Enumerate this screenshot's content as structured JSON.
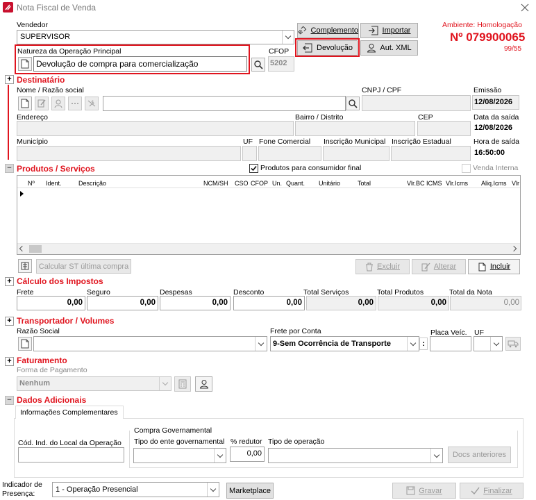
{
  "window": {
    "title": "Nota Fiscal de Venda"
  },
  "header": {
    "ambiente": "Ambiente: Homologação",
    "numero": "Nº 079900065",
    "serie": "99/55",
    "vendedor_label": "Vendedor",
    "vendedor_value": "SUPERVISOR",
    "natureza_label": "Natureza da Operação Principal",
    "natureza_value": "Devolução de compra para comercialização",
    "cfop_label": "CFOP",
    "cfop_value": "5202",
    "btn_complemento": "Complemento",
    "btn_importar": "Importar",
    "btn_devolucao": "Devolução",
    "btn_autxml": "Aut. XML"
  },
  "destinatario": {
    "title": "Destinatário",
    "nome_label": "Nome / Razão social",
    "cnpj_label": "CNPJ / CPF",
    "emissao_label": "Emissão",
    "emissao_value": "12/08/2026",
    "endereco_label": "Endereço",
    "bairro_label": "Bairro / Distrito",
    "cep_label": "CEP",
    "data_saida_label": "Data da saída",
    "data_saida_value": "12/08/2026",
    "municipio_label": "Município",
    "uf_label": "UF",
    "fone_label": "Fone Comercial",
    "im_label": "Inscrição Municipal",
    "ie_label": "Inscrição Estadual",
    "hora_saida_label": "Hora de saída",
    "hora_saida_value": "16:50:00"
  },
  "produtos": {
    "title": "Produtos / Serviços",
    "consumidor_final": "Produtos para consumidor final",
    "venda_interna": "Venda Interna",
    "columns": [
      "Nº",
      "Ident.",
      "Descrição",
      "NCM/SH",
      "CSO",
      "CFOP",
      "Un.",
      "Quant.",
      "Unitário",
      "Total",
      "Vlr.BC ICMS",
      "Vlr.Icms",
      "Aliq.Icms",
      "Vlr"
    ],
    "btn_calcular": "Calcular ST última compra",
    "btn_excluir": "Excluir",
    "btn_alterar": "Alterar",
    "btn_incluir": "Incluir"
  },
  "impostos": {
    "title": "Cálculo dos Impostos",
    "fields": [
      {
        "label": "Frete",
        "value": "0,00"
      },
      {
        "label": "Seguro",
        "value": "0,00"
      },
      {
        "label": "Despesas",
        "value": "0,00"
      },
      {
        "label": "Desconto",
        "value": "0,00"
      },
      {
        "label": "Total Serviços",
        "value": "0,00"
      },
      {
        "label": "Total Produtos",
        "value": "0,00"
      },
      {
        "label": "Total da Nota",
        "value": "0,00"
      }
    ]
  },
  "transportador": {
    "title": "Transportador / Volumes",
    "razao_label": "Razão Social",
    "frete_label": "Frete por Conta",
    "frete_value": "9-Sem Ocorrência de Transporte",
    "placa_label": "Placa Veíc.",
    "uf_label": "UF",
    "sep": ":"
  },
  "faturamento": {
    "title": "Faturamento",
    "forma_label": "Forma de Pagamento",
    "forma_value": "Nenhum"
  },
  "dados": {
    "title": "Dados Adicionais",
    "tab": "Informações Complementares",
    "compra_gov": "Compra Governamental",
    "cod_local_label": "Cód. Ind. do Local da Operação",
    "tipo_ente_label": "Tipo do ente governamental",
    "redutor_label": "% redutor",
    "redutor_value": "0,00",
    "tipo_op_label": "Tipo de operação",
    "btn_docs": "Docs anteriores"
  },
  "footer": {
    "indicador_label_1": "Indicador de",
    "indicador_label_2": "Presença:",
    "indicador_value": "1 - Operação Presencial",
    "btn_marketplace": "Marketplace",
    "btn_gravar": "Gravar",
    "btn_finalizar": "Finalizar"
  },
  "colors": {
    "accent": "#e0141e"
  }
}
